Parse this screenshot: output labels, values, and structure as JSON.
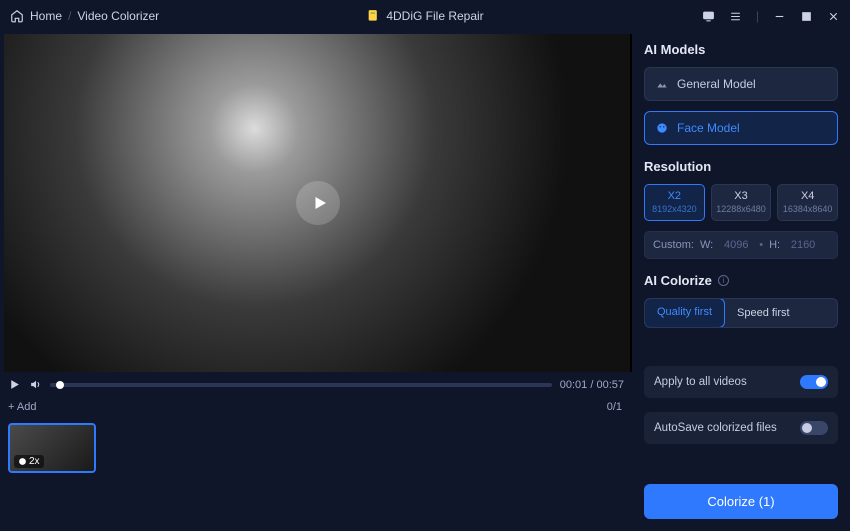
{
  "breadcrumb": {
    "home": "Home",
    "page": "Video Colorizer"
  },
  "app": {
    "title": "4DDiG File Repair"
  },
  "player": {
    "current": "00:01",
    "total": "00:57",
    "add_label": "Add",
    "count": "0/1",
    "thumb_badge": "2x"
  },
  "panel": {
    "models_title": "AI Models",
    "models": [
      {
        "label": "General Model",
        "selected": false
      },
      {
        "label": "Face Model",
        "selected": true
      }
    ],
    "resolution_title": "Resolution",
    "resolutions": [
      {
        "mult": "X2",
        "dim": "8192x4320",
        "selected": true
      },
      {
        "mult": "X3",
        "dim": "12288x6480",
        "selected": false
      },
      {
        "mult": "X4",
        "dim": "16384x8640",
        "selected": false
      }
    ],
    "custom": {
      "label": "Custom:",
      "w_label": "W:",
      "w": "4096",
      "h_label": "H:",
      "h": "2160"
    },
    "colorize_title": "AI Colorize",
    "modes": [
      {
        "label": "Quality first",
        "selected": true
      },
      {
        "label": "Speed first",
        "selected": false
      }
    ],
    "toggles": {
      "apply": {
        "label": "Apply to all videos",
        "on": true
      },
      "autosave": {
        "label": "AutoSave colorized files",
        "on": false
      }
    },
    "cta": "Colorize (1)"
  }
}
